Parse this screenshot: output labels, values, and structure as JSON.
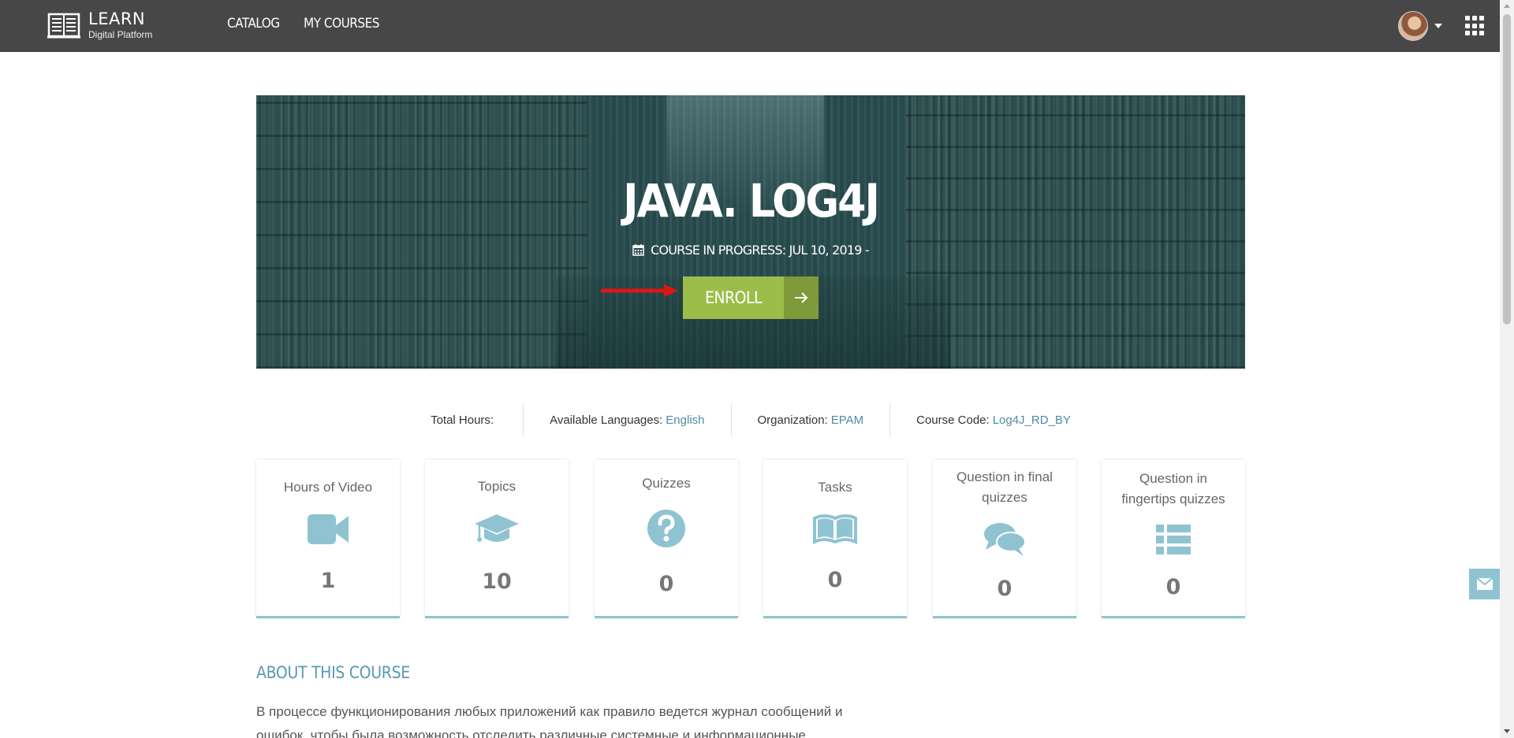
{
  "header": {
    "logo_title": "LEARN",
    "logo_subtitle": "Digital Platform",
    "nav": [
      {
        "label": "CATALOG"
      },
      {
        "label": "MY COURSES"
      }
    ]
  },
  "course": {
    "title": "JAVA. LOG4J",
    "status": "COURSE IN PROGRESS: JUL 10, 2019 -",
    "enroll_label": "ENROLL"
  },
  "meta": {
    "total_hours_label": "Total Hours:",
    "total_hours_value": "",
    "languages_label": "Available Languages:",
    "languages_value": "English",
    "organization_label": "Organization:",
    "organization_value": "EPAM",
    "code_label": "Course Code:",
    "code_value": "Log4J_RD_BY"
  },
  "stats": [
    {
      "title": "Hours of Video",
      "value": "1",
      "icon": "video-camera-icon"
    },
    {
      "title": "Topics",
      "value": "10",
      "icon": "graduation-cap-icon"
    },
    {
      "title": "Quizzes",
      "value": "0",
      "icon": "question-circle-icon"
    },
    {
      "title": "Tasks",
      "value": "0",
      "icon": "open-book-icon"
    },
    {
      "title": "Question in final quizzes",
      "value": "0",
      "icon": "comments-icon"
    },
    {
      "title": "Question in fingertips quizzes",
      "value": "0",
      "icon": "list-icon"
    }
  ],
  "about": {
    "title": "ABOUT THIS COURSE",
    "text": "В процессе функционирования любых приложений как правило ведется журнал сообщений и ошибок, чтобы была возможность отследить различные системные и информационные"
  },
  "colors": {
    "topbar": "#474747",
    "accent": "#5a97b2",
    "enroll": "#9cbd4a",
    "card_border": "#8fc3d1"
  }
}
